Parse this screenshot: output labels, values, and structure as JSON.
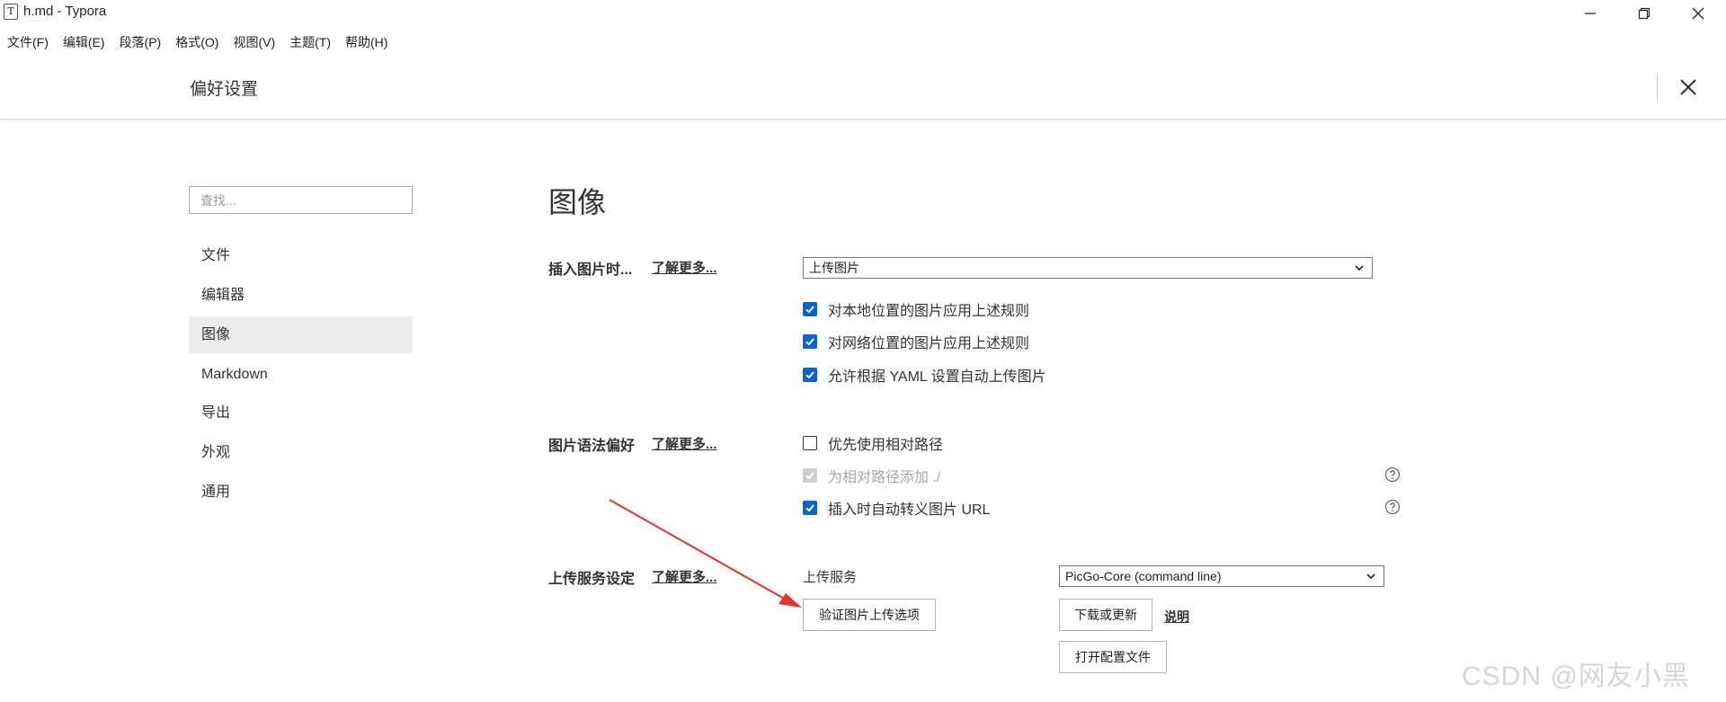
{
  "window": {
    "app_icon_letter": "T",
    "title": "h.md - Typora"
  },
  "menubar": [
    "文件(F)",
    "编辑(E)",
    "段落(P)",
    "格式(O)",
    "视图(V)",
    "主题(T)",
    "帮助(H)"
  ],
  "preferences": {
    "title": "偏好设置"
  },
  "sidebar": {
    "search_placeholder": "查找...",
    "items": [
      "文件",
      "编辑器",
      "图像",
      "Markdown",
      "导出",
      "外观",
      "通用"
    ],
    "active_index": 2
  },
  "content": {
    "section_title": "图像",
    "insert_image": {
      "label": "插入图片时...",
      "learn_more": "了解更多...",
      "select_value": "上传图片",
      "checkboxes": [
        {
          "label": "对本地位置的图片应用上述规则",
          "checked": true
        },
        {
          "label": "对网络位置的图片应用上述规则",
          "checked": true
        },
        {
          "label": "允许根据 YAML 设置自动上传图片",
          "checked": true
        }
      ]
    },
    "syntax_pref": {
      "label": "图片语法偏好",
      "learn_more": "了解更多...",
      "checkboxes": [
        {
          "label": "优先使用相对路径",
          "checked": false
        },
        {
          "label": "为相对路径添加 ./",
          "checked": true,
          "disabled": true
        },
        {
          "label": "插入时自动转义图片 URL",
          "checked": true
        }
      ]
    },
    "upload_service": {
      "label": "上传服务设定",
      "learn_more": "了解更多...",
      "service_label": "上传服务",
      "service_value": "PicGo-Core (command line)",
      "verify_button": "验证图片上传选项",
      "download_button": "下载或更新",
      "explain_link": "说明",
      "open_config_button": "打开配置文件"
    }
  },
  "watermark": "CSDN @网友小黑",
  "colors": {
    "accent": "#0b63ce",
    "annotation_arrow": "#e8322a"
  }
}
